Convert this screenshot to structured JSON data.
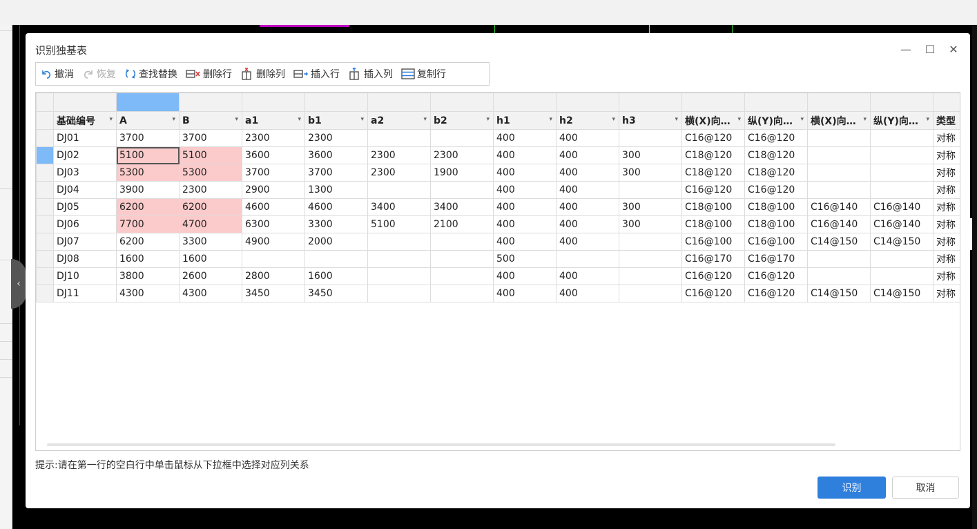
{
  "dialog": {
    "title": "识别独基表",
    "minimize_glyph": "—",
    "maximize_glyph": "☐",
    "close_glyph": "✕"
  },
  "toolbar": [
    {
      "name": "undo-button",
      "icon": "undo-icon",
      "label": "撤消",
      "enabled": true
    },
    {
      "name": "redo-button",
      "icon": "redo-icon",
      "label": "恢复",
      "enabled": false
    },
    {
      "name": "find-replace-button",
      "icon": "find-replace-icon",
      "label": "查找替换",
      "enabled": true
    },
    {
      "name": "delete-row-button",
      "icon": "delete-row-icon",
      "label": "删除行",
      "enabled": true
    },
    {
      "name": "delete-column-button",
      "icon": "delete-column-icon",
      "label": "删除列",
      "enabled": true
    },
    {
      "name": "insert-row-button",
      "icon": "insert-row-icon",
      "label": "插入行",
      "enabled": true
    },
    {
      "name": "insert-column-button",
      "icon": "insert-column-icon",
      "label": "插入列",
      "enabled": true
    },
    {
      "name": "copy-row-button",
      "icon": "copy-row-icon",
      "label": "复制行",
      "enabled": true
    }
  ],
  "table": {
    "columns": [
      "基础编号",
      "A",
      "B",
      "a1",
      "b1",
      "a2",
      "b2",
      "h1",
      "h2",
      "h3",
      "横(X)向…",
      "纵(Y)向…",
      "横(X)向…",
      "纵(Y)向…",
      "类型"
    ],
    "rows": [
      [
        "DJ01",
        "3700",
        "3700",
        "2300",
        "2300",
        "",
        "",
        "400",
        "400",
        "",
        "C16@120",
        "C16@120",
        "",
        "",
        "对称"
      ],
      [
        "DJ02",
        "5100",
        "5100",
        "3600",
        "3600",
        "2300",
        "2300",
        "400",
        "400",
        "300",
        "C18@120",
        "C18@120",
        "",
        "",
        "对称"
      ],
      [
        "DJ03",
        "5300",
        "5300",
        "3700",
        "3700",
        "2300",
        "1900",
        "400",
        "400",
        "300",
        "C18@120",
        "C18@120",
        "",
        "",
        "对称"
      ],
      [
        "DJ04",
        "3900",
        "2300",
        "2900",
        "1300",
        "",
        "",
        "400",
        "400",
        "",
        "C16@120",
        "C16@120",
        "",
        "",
        "对称"
      ],
      [
        "DJ05",
        "6200",
        "6200",
        "4600",
        "4600",
        "3400",
        "3400",
        "400",
        "400",
        "300",
        "C18@100",
        "C18@100",
        "C16@140",
        "C16@140",
        "对称"
      ],
      [
        "DJ06",
        "7700",
        "4700",
        "6300",
        "3300",
        "5100",
        "2100",
        "400",
        "400",
        "300",
        "C18@100",
        "C18@100",
        "C16@140",
        "C16@140",
        "对称"
      ],
      [
        "DJ07",
        "6200",
        "3300",
        "4900",
        "2000",
        "",
        "",
        "400",
        "400",
        "",
        "C16@100",
        "C16@100",
        "C14@150",
        "C14@150",
        "对称"
      ],
      [
        "DJ08",
        "1600",
        "1600",
        "",
        "",
        "",
        "",
        "500",
        "",
        "",
        "C16@170",
        "C16@170",
        "",
        "",
        "对称"
      ],
      [
        "DJ10",
        "3800",
        "2600",
        "2800",
        "1600",
        "",
        "",
        "400",
        "400",
        "",
        "C16@120",
        "C16@120",
        "",
        "",
        "对称"
      ],
      [
        "DJ11",
        "4300",
        "4300",
        "3450",
        "3450",
        "",
        "",
        "400",
        "400",
        "",
        "C16@120",
        "C16@120",
        "C14@150",
        "C14@150",
        "对称"
      ]
    ],
    "highlighted_cells": [
      [
        1,
        1
      ],
      [
        1,
        2
      ],
      [
        2,
        1
      ],
      [
        2,
        2
      ],
      [
        4,
        1
      ],
      [
        4,
        2
      ],
      [
        5,
        1
      ],
      [
        5,
        2
      ]
    ],
    "current_cell": [
      1,
      1
    ],
    "selected_row": 1,
    "selected_column": 1,
    "colors": {
      "highlight": "#fbcaca",
      "selection": "#7eb9f8"
    }
  },
  "hint": "提示:请在第一行的空白行中单击鼠标从下拉框中选择对应列关系",
  "buttons": {
    "ok": "识别",
    "cancel": "取消"
  },
  "colors": {
    "primary": "#2f7fdd"
  }
}
